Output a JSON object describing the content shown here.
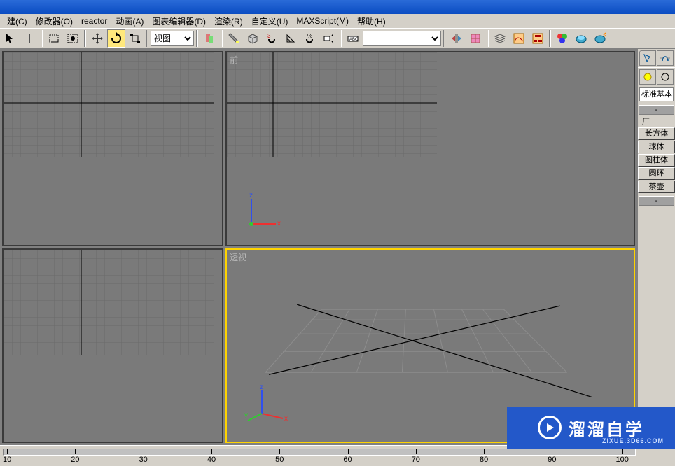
{
  "menu": {
    "items": [
      "建(C)",
      "修改器(O)",
      "reactor",
      "动画(A)",
      "图表编辑器(D)",
      "渲染(R)",
      "自定义(U)",
      "MAXScript(M)",
      "帮助(H)"
    ]
  },
  "toolbar": {
    "combo_main": "视图",
    "combo_sel": ""
  },
  "viewports": {
    "top_left": "",
    "top_right": "前",
    "bottom_left": "",
    "bottom_right": "透视"
  },
  "panel": {
    "combo": "标准基本",
    "section_header": "-",
    "auto_grid_label": "厂",
    "objects": [
      "长方体",
      "球体",
      "圆柱体",
      "圆环",
      "茶壶"
    ],
    "section2_header": "-"
  },
  "timeline": {
    "labels": [
      "10",
      "20",
      "30",
      "40",
      "50",
      "60",
      "70",
      "80",
      "90",
      "100"
    ]
  },
  "watermark": {
    "title": "溜溜自学",
    "sub": "ZIXUE.3D66.COM"
  }
}
